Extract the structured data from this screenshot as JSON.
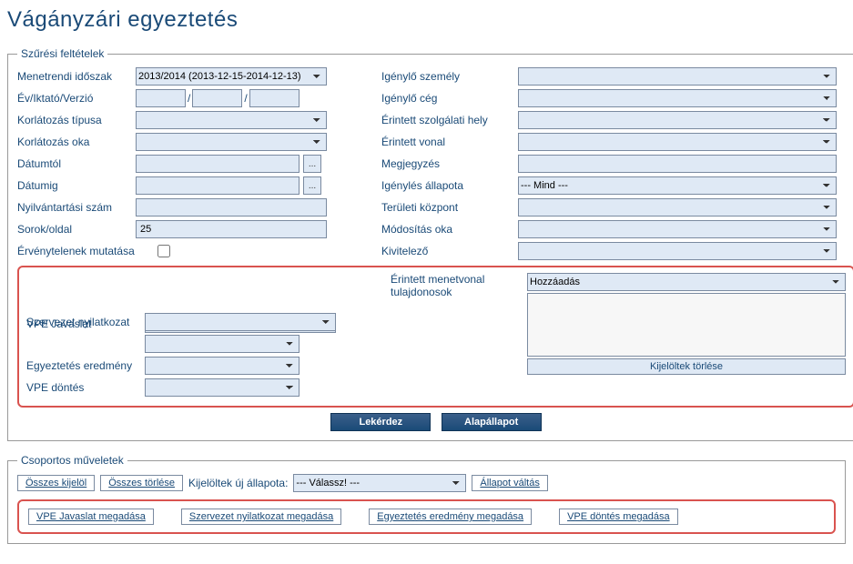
{
  "page": {
    "title": "Vágányzári egyeztetés"
  },
  "filters": {
    "legend": "Szűrési feltételek",
    "left": {
      "timetable_label": "Menetrendi időszak",
      "timetable_value": "2013/2014 (2013-12-15-2014-12-13)",
      "year_label": "Év/Iktató/Verzió",
      "year_sep": "/",
      "restriction_type_label": "Korlátozás típusa",
      "restriction_reason_label": "Korlátozás oka",
      "date_from_label": "Dátumtól",
      "date_to_label": "Dátumig",
      "reg_no_label": "Nyilvántartási szám",
      "rows_label": "Sorok/oldal",
      "rows_value": "25",
      "show_invalid_label": "Érvénytelenek mutatása",
      "date_picker_icon": "..."
    },
    "right": {
      "req_person_label": "Igénylő személy",
      "req_company_label": "Igénylő cég",
      "station_label": "Érintett szolgálati hely",
      "line_label": "Érintett vonal",
      "note_label": "Megjegyzés",
      "req_status_label": "Igénylés állapota",
      "req_status_value": "--- Mind ---",
      "regional_label": "Területi központ",
      "mod_reason_label": "Módosítás oka",
      "contractor_label": "Kivitelező"
    },
    "hl": {
      "vpe_proposal_label": "VPE Javaslat",
      "org_decl_label": "Szervezet nyilatkozat",
      "agree_result_label": "Egyeztetés eredmény",
      "vpe_decision_label": "VPE döntés",
      "owners_label": "Érintett menetvonal tulajdonosok",
      "add_label": "Hozzáadás",
      "delete_selected": "Kijelöltek törlése"
    },
    "actions": {
      "query": "Lekérdez",
      "reset": "Alapállapot"
    }
  },
  "group": {
    "legend": "Csoportos műveletek",
    "select_all": "Összes kijelöl",
    "clear_all": "Összes törlése",
    "new_state_label": "Kijelöltek új állapota:",
    "new_state_value": "--- Válassz! ---",
    "change_state": "Állapot váltás",
    "hl": {
      "vpe_proposal": "VPE Javaslat megadása",
      "org_decl": "Szervezet nyilatkozat megadása",
      "agree_result": "Egyeztetés eredmény megadása",
      "vpe_decision": "VPE döntés megadása"
    }
  }
}
